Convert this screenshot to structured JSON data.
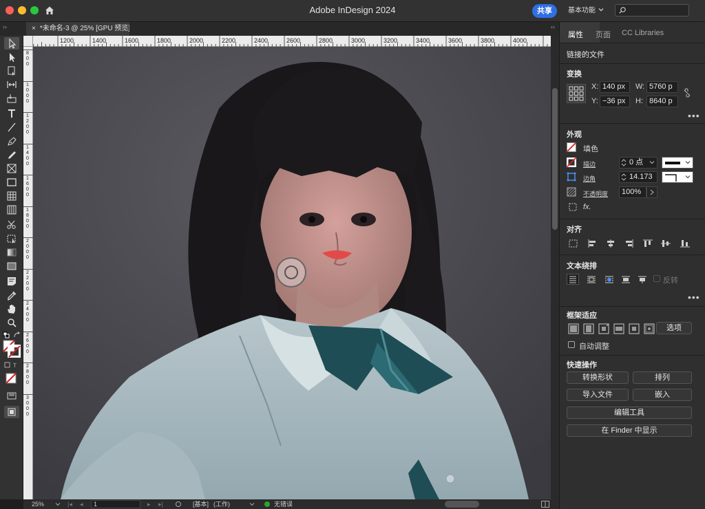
{
  "window": {
    "title": "Adobe InDesign 2024",
    "share_label": "共享",
    "workspace_label": "基本功能",
    "document_tab": "*未命名-3 @ 25% [GPU 预览]",
    "close_tab_glyph": "×"
  },
  "rulers": {
    "horizontal": [
      "1200",
      "1400",
      "1600",
      "1800",
      "2000",
      "2200",
      "2400",
      "2600",
      "2800",
      "3000",
      "3200",
      "3400",
      "3600",
      "3800",
      "4000"
    ],
    "vertical": [
      "800",
      "1000",
      "1200",
      "1400",
      "1600",
      "1800",
      "2000",
      "2200",
      "2400",
      "2600",
      "2800",
      "3000"
    ]
  },
  "status": {
    "zoom": "25%",
    "page": "1",
    "style": "[基本]",
    "mode": "(工作)",
    "preflight": "无错误",
    "preflight_color": "#2aa52a"
  },
  "panel": {
    "tabs": [
      "属性",
      "页面",
      "CC Libraries"
    ],
    "linked_file": "链接的文件",
    "transform": {
      "title": "变换",
      "x_label": "X:",
      "x_value": "140 px",
      "y_label": "Y:",
      "y_value": "−36 px",
      "w_label": "W:",
      "w_value": "5760 p",
      "h_label": "H:",
      "h_value": "8640 p"
    },
    "appearance": {
      "title": "外观",
      "fill_label": "填色",
      "stroke_label": "描边",
      "stroke_value": "0 点",
      "corner_label": "边角",
      "corner_value": "14.173",
      "opacity_label": "不透明度",
      "opacity_value": "100%",
      "fx_label": "fx."
    },
    "align": {
      "title": "对齐"
    },
    "text_wrap": {
      "title": "文本绕排",
      "invert_label": "反转"
    },
    "frame_fitting": {
      "title": "框架适应",
      "options_label": "选项",
      "auto_fit_label": "自动调整"
    },
    "quick_actions": {
      "title": "快速操作",
      "convert_shape": "转换形状",
      "arrange": "排列",
      "import_file": "导入文件",
      "embed": "嵌入",
      "edit_tool": "编辑工具",
      "show_in_finder": "在 Finder 中显示"
    },
    "more_glyph": "•••"
  },
  "icons": [
    "home-icon",
    "search-icon",
    "selection-tool-icon",
    "direct-selection-tool-icon",
    "page-tool-icon",
    "gap-tool-icon",
    "content-collector-icon",
    "type-tool-icon",
    "line-tool-icon",
    "pen-tool-icon",
    "pencil-tool-icon",
    "rectangle-frame-tool-icon",
    "rectangle-tool-icon",
    "table-icon",
    "scissors-tool-icon",
    "free-transform-tool-icon",
    "gradient-swatch-icon",
    "note-tool-icon",
    "eyedropper-tool-icon",
    "hand-tool-icon",
    "zoom-tool-icon",
    "fill-stroke-icon",
    "link-icon",
    "content-grabber-icon"
  ],
  "colors": {
    "accent": "#2f6fe4",
    "fill_none": "#d42020"
  }
}
